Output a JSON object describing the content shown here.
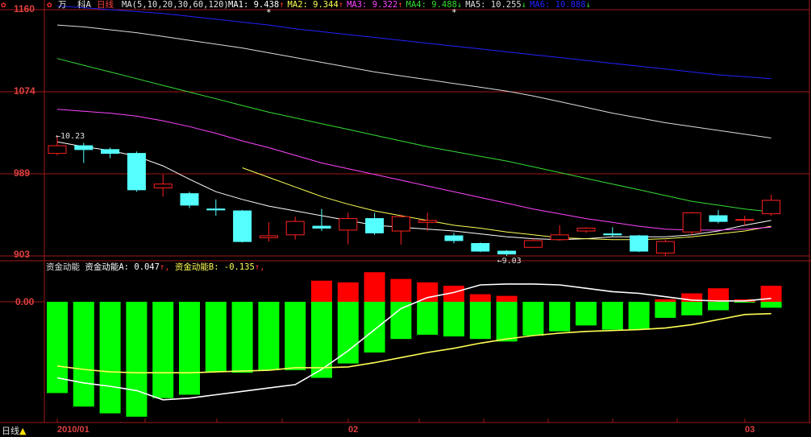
{
  "header": {
    "stock_prefix": "万",
    "stock_suffix": "科A",
    "period": "日线",
    "ma_params": "MA(5,10,20,30,60,120)",
    "ma_values": [
      {
        "label": "MA1:",
        "value": "9.438",
        "arrow": "↑",
        "color": "#ffffff"
      },
      {
        "label": "MA2:",
        "value": "9.344",
        "arrow": "↑",
        "color": "#ffff55"
      },
      {
        "label": "MA3:",
        "value": "9.322",
        "arrow": "↑",
        "color": "#ff44ff"
      },
      {
        "label": "MA4:",
        "value": "9.488",
        "arrow": "↓",
        "color": "#33dd33"
      },
      {
        "label": "MA5:",
        "value": "10.255",
        "arrow": "↓",
        "color": "#dddddd"
      },
      {
        "label": "MA6:",
        "value": "10.888",
        "arrow": "↓",
        "color": "#2222ff"
      }
    ],
    "asterisk": "*"
  },
  "sub_header": {
    "name": "资金动能",
    "a_label": "资金动能A:",
    "a_value": "0.047",
    "a_arrow": "↑,",
    "b_label": "资金动能B:",
    "b_value": "-0.135",
    "b_arrow": "↑,"
  },
  "bottom_bar": {
    "period": "日线",
    "x_labels": [
      "2010/01",
      "02",
      "03"
    ]
  },
  "colors": {
    "frame": "#a01818",
    "up": "#ff2020",
    "down": "#54ffff",
    "osc_up": "#ff0000",
    "osc_down": "#00ff00",
    "ma1": "#ffffff",
    "ma2": "#ffff55",
    "ma3": "#ff44ff",
    "ma4": "#33dd33",
    "ma5": "#dddddd",
    "ma6": "#2222ff",
    "line_a": "#ffffff",
    "line_b": "#ffff55"
  },
  "chart_data": [
    {
      "type": "candlestick",
      "title": "万科A 日线",
      "y_ticks": [
        "1160",
        "1074",
        "989",
        "903"
      ],
      "y_tick_values": [
        11.6,
        10.74,
        9.89,
        9.03
      ],
      "ylim": [
        9.03,
        11.6
      ],
      "annotations": [
        {
          "text": "←10.23",
          "index": 0,
          "value": 10.23
        },
        {
          "text": "←9.03",
          "index": 17,
          "value": 9.03
        }
      ],
      "candles": [
        {
          "o": 10.1,
          "c": 10.18,
          "h": 10.28,
          "l": 10.08
        },
        {
          "o": 10.18,
          "c": 10.14,
          "h": 10.21,
          "l": 10.0
        },
        {
          "o": 10.14,
          "c": 10.1,
          "h": 10.16,
          "l": 10.05
        },
        {
          "o": 10.1,
          "c": 9.72,
          "h": 10.12,
          "l": 9.7
        },
        {
          "o": 9.74,
          "c": 9.78,
          "h": 9.88,
          "l": 9.65
        },
        {
          "o": 9.68,
          "c": 9.56,
          "h": 9.7,
          "l": 9.53
        },
        {
          "o": 9.52,
          "c": 9.51,
          "h": 9.62,
          "l": 9.45
        },
        {
          "o": 9.5,
          "c": 9.18,
          "h": 9.51,
          "l": 9.17
        },
        {
          "o": 9.22,
          "c": 9.24,
          "h": 9.38,
          "l": 9.18
        },
        {
          "o": 9.25,
          "c": 9.39,
          "h": 9.44,
          "l": 9.2
        },
        {
          "o": 9.34,
          "c": 9.32,
          "h": 9.52,
          "l": 9.29
        },
        {
          "o": 9.3,
          "c": 9.42,
          "h": 9.48,
          "l": 9.15
        },
        {
          "o": 9.42,
          "c": 9.27,
          "h": 9.48,
          "l": 9.25
        },
        {
          "o": 9.29,
          "c": 9.44,
          "h": 9.46,
          "l": 9.15
        },
        {
          "o": 9.38,
          "c": 9.4,
          "h": 9.48,
          "l": 9.29
        },
        {
          "o": 9.24,
          "c": 9.19,
          "h": 9.27,
          "l": 9.16
        },
        {
          "o": 9.16,
          "c": 9.08,
          "h": 9.17,
          "l": 9.07
        },
        {
          "o": 9.08,
          "c": 9.05,
          "h": 9.09,
          "l": 9.03
        },
        {
          "o": 9.12,
          "c": 9.19,
          "h": 9.21,
          "l": 9.12
        },
        {
          "o": 9.2,
          "c": 9.25,
          "h": 9.35,
          "l": 9.19
        },
        {
          "o": 9.29,
          "c": 9.32,
          "h": 9.33,
          "l": 9.27
        },
        {
          "o": 9.26,
          "c": 9.25,
          "h": 9.33,
          "l": 9.23
        },
        {
          "o": 9.24,
          "c": 9.08,
          "h": 9.25,
          "l": 9.07
        },
        {
          "o": 9.06,
          "c": 9.18,
          "h": 9.2,
          "l": 9.03
        },
        {
          "o": 9.28,
          "c": 9.48,
          "h": 9.49,
          "l": 9.25
        },
        {
          "o": 9.45,
          "c": 9.39,
          "h": 9.51,
          "l": 9.37
        },
        {
          "o": 9.41,
          "c": 9.41,
          "h": 9.45,
          "l": 9.35
        },
        {
          "o": 9.47,
          "c": 9.61,
          "h": 9.67,
          "l": 9.45
        }
      ],
      "ma_series": [
        {
          "name": "MA1",
          "values": [
            10.22,
            10.17,
            10.13,
            10.07,
            9.97,
            9.83,
            9.7,
            9.62,
            9.55,
            9.5,
            9.45,
            9.4,
            9.35,
            9.33,
            9.31,
            9.29,
            9.26,
            9.23,
            9.21,
            9.2,
            9.21,
            9.23,
            9.23,
            9.23,
            9.25,
            9.29,
            9.35,
            9.4
          ]
        },
        {
          "name": "MA2",
          "values": [
            null,
            null,
            null,
            null,
            null,
            null,
            null,
            9.95,
            9.85,
            9.75,
            9.65,
            9.57,
            9.5,
            9.45,
            9.4,
            9.35,
            9.32,
            9.28,
            9.25,
            9.22,
            9.21,
            9.2,
            9.2,
            9.21,
            9.23,
            9.26,
            9.29,
            9.34
          ]
        },
        {
          "name": "MA3",
          "values": [
            10.56,
            10.54,
            10.52,
            10.49,
            10.44,
            10.38,
            10.31,
            10.23,
            10.16,
            10.08,
            10.0,
            9.94,
            9.88,
            9.82,
            9.76,
            9.7,
            9.64,
            9.58,
            9.52,
            9.47,
            9.42,
            9.38,
            9.34,
            9.31,
            9.3,
            9.3,
            9.31,
            9.33
          ]
        },
        {
          "name": "MA4",
          "values": [
            11.09,
            11.02,
            10.95,
            10.88,
            10.81,
            10.74,
            10.67,
            10.6,
            10.53,
            10.47,
            10.41,
            10.35,
            10.29,
            10.23,
            10.17,
            10.12,
            10.07,
            10.02,
            9.96,
            9.9,
            9.84,
            9.78,
            9.72,
            9.66,
            9.6,
            9.56,
            9.52,
            9.49
          ]
        },
        {
          "name": "MA5",
          "values": [
            11.44,
            11.42,
            11.39,
            11.36,
            11.32,
            11.28,
            11.24,
            11.2,
            11.15,
            11.1,
            11.05,
            11.0,
            10.95,
            10.91,
            10.87,
            10.83,
            10.79,
            10.75,
            10.7,
            10.64,
            10.58,
            10.52,
            10.47,
            10.42,
            10.38,
            10.34,
            10.3,
            10.26
          ]
        },
        {
          "name": "MA6",
          "values": [
            11.64,
            11.62,
            11.6,
            11.58,
            11.56,
            11.53,
            11.5,
            11.47,
            11.44,
            11.4,
            11.37,
            11.34,
            11.31,
            11.28,
            11.25,
            11.22,
            11.19,
            11.16,
            11.13,
            11.1,
            11.07,
            11.04,
            11.01,
            10.98,
            10.95,
            10.92,
            10.9,
            10.88
          ]
        }
      ]
    },
    {
      "type": "bar",
      "title": "资金动能",
      "y_ticks": [
        "0.00"
      ],
      "ylim": [
        -1.4,
        0.38
      ],
      "green_bars": [
        -1.08,
        -1.24,
        -1.32,
        -1.36,
        -1.14,
        -1.1,
        -0.83,
        -0.84,
        -0.81,
        -0.81,
        -0.9,
        -0.73,
        -0.6,
        -0.44,
        -0.39,
        -0.41,
        -0.44,
        -0.47,
        -0.4,
        -0.35,
        -0.28,
        -0.33,
        -0.33,
        -0.19,
        -0.16,
        -0.1,
        -0.01,
        -0.07
      ],
      "red_bars": [
        0,
        0,
        0,
        0,
        0,
        0,
        0,
        0,
        0,
        0,
        0.25,
        0.23,
        0.35,
        0.27,
        0.23,
        0.19,
        0.09,
        0.07,
        0,
        0,
        0,
        0,
        0,
        0.03,
        0.1,
        0.16,
        0.03,
        0.19
      ],
      "line_a": [
        -0.9,
        -0.96,
        -1.0,
        -1.05,
        -1.16,
        -1.14,
        -1.1,
        -1.06,
        -1.02,
        -0.98,
        -0.8,
        -0.58,
        -0.33,
        -0.08,
        0.05,
        0.11,
        0.2,
        0.21,
        0.21,
        0.2,
        0.16,
        0.12,
        0.1,
        0.06,
        0.02,
        0.01,
        0.01,
        0.04
      ],
      "line_b": [
        -0.76,
        -0.8,
        -0.83,
        -0.84,
        -0.84,
        -0.84,
        -0.83,
        -0.82,
        -0.81,
        -0.78,
        -0.78,
        -0.77,
        -0.72,
        -0.66,
        -0.6,
        -0.55,
        -0.49,
        -0.44,
        -0.4,
        -0.37,
        -0.35,
        -0.34,
        -0.33,
        -0.31,
        -0.27,
        -0.21,
        -0.15,
        -0.14
      ]
    }
  ]
}
